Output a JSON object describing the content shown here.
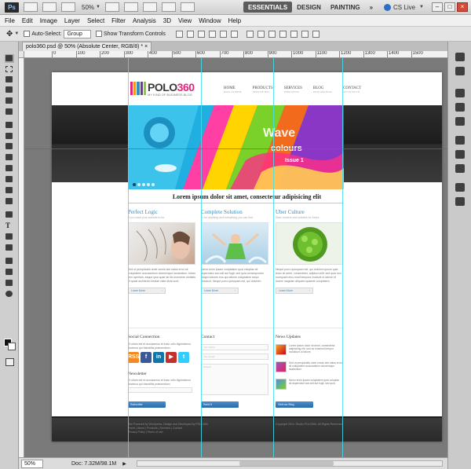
{
  "app": {
    "logo": "Ps",
    "zoom": "50%",
    "workspaces": [
      "ESSENTIALS",
      "DESIGN",
      "PAINTING"
    ],
    "more": "»",
    "cs_live": "CS Live",
    "win_min": "–",
    "win_max": "□",
    "win_close": "×"
  },
  "menu": [
    "File",
    "Edit",
    "Image",
    "Layer",
    "Select",
    "Filter",
    "Analysis",
    "3D",
    "View",
    "Window",
    "Help"
  ],
  "options": {
    "auto_select_label": "Auto-Select:",
    "auto_select_value": "Group",
    "transform_label": "Show Transform Controls"
  },
  "doc_tab": "polo360.psd @ 50% (Absolute Center, RGB/8) * ×",
  "ruler_ticks": [
    "0",
    "100",
    "200",
    "300",
    "400",
    "500",
    "600",
    "700",
    "800",
    "900",
    "1000",
    "1100",
    "1200",
    "1300",
    "1400",
    "1500"
  ],
  "site": {
    "logo_main": "POLO",
    "logo_accent": "360",
    "tagline": "MY KIND OF BUSINESS BLOG",
    "nav": [
      {
        "label": "HOME",
        "sub": "Back to home"
      },
      {
        "label": "PRODUCTS",
        "sub": "What we sell"
      },
      {
        "label": "SERVICES",
        "sub": "What we do"
      },
      {
        "label": "BLOG",
        "sub": "Read our blog"
      },
      {
        "label": "CONTACT",
        "sub": "Get in touch"
      }
    ],
    "hero_text": [
      "Wave",
      "colours",
      "Issue 1"
    ],
    "headline": "Lorem ipsum dolor sit amet, consectetur adipisicing elit",
    "columns": [
      {
        "title": "Perfect Logic",
        "sub": "If you want your website to be",
        "body": "Sed ut perspiciatis unde omnis iste natus error sit voluptatem accusantium doloremque laudantium, totam rem aperiam, eaque ipsa quae ab illo inventore veritatis et quasi architecto beatae vitae dicta sunt.",
        "link": "Learn More"
      },
      {
        "title": "Complete Solution",
        "sub": "In for anything and everything you can find",
        "body": "Nemo enim ipsam voluptatem quia voluptas sit aspernatur aut odit aut fugit, sed quia consequuntur magni dolores eos qui ratione voluptatem sequi nesciunt. Neque porro quisquam est, qui dolorem.",
        "link": "Learn More"
      },
      {
        "title": "Uber Culture",
        "sub": "Stain modern and suitable for future",
        "body": "Neque porro quisquam est, qui dolorem ipsum quia dolor sit amet, consectetur, adipisci velit, sed quia non numquam eius modi tempora incidunt ut labore et dolore magnam aliquam quaerat voluptatem.",
        "link": "Learn More"
      }
    ],
    "social": {
      "title": "Social Connection",
      "text": "Et ullam est et accusamus et iusto odio dignissimos ducimus qui blanditiis praesentium",
      "icons": [
        "RSS",
        "f",
        "in",
        "▶",
        "t"
      ]
    },
    "newsletter": {
      "title": "Newsletter",
      "text": "Et ullam est et accusamus et iusto odio dignissimos ducimus qui blanditiis praesentium",
      "button": "Subscribe"
    },
    "contact": {
      "title": "Contact",
      "fields": [
        "Your Name",
        "Your Email",
        "Subject"
      ],
      "button": "Send It"
    },
    "news": {
      "title": "News Updates",
      "items": [
        "Lorem ipsum dolor sit amet, consectetur adipisicing elit, sed do eiusmod tempor incididunt ut labore",
        "Sed ut perspiciatis unde omnis iste natus error sit voluptatem accusantium doloremque laudantium",
        "Nemo enim ipsam voluptatem quia voluptas sit aspernatur aut odit aut fugit, sed quia"
      ],
      "button": "Visit our Blog"
    },
    "footer_left": "Site Powered by Wordpress. Design and Developed by POLO360\nHome | About | Products | Services | Contact\nPrivacy Policy | Terms of use",
    "footer_right": "Copyright 2010. Studio POLO360. All Rights Reserved."
  },
  "status": {
    "zoom": "50%",
    "doc": "Doc: 7.32M/98.1M",
    "arrow": "▶"
  }
}
